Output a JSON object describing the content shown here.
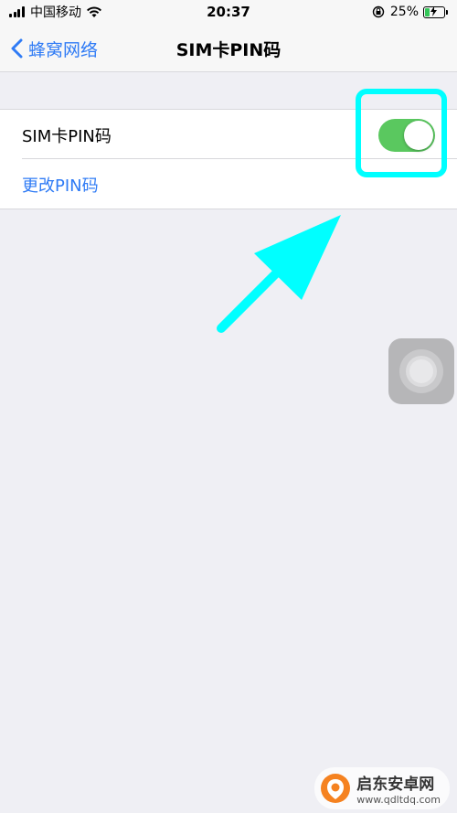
{
  "status_bar": {
    "carrier": "中国移动",
    "time": "20:37",
    "battery_percent": "25%",
    "battery_level": 0.25,
    "icons": [
      "signal-icon",
      "wifi-icon",
      "orientation-lock-icon",
      "battery-charging-icon"
    ]
  },
  "nav": {
    "back_label": "蜂窝网络",
    "title": "SIM卡PIN码"
  },
  "settings": {
    "sim_pin_label": "SIM卡PIN码",
    "sim_pin_enabled": true,
    "change_pin_label": "更改PIN码"
  },
  "colors": {
    "accent": "#2f7bf5",
    "toggle_on": "#5ac85f",
    "highlight": "#00ffff",
    "background": "#efeff4"
  },
  "watermark": {
    "name": "启东安卓网",
    "url": "www.qdltdq.com"
  }
}
